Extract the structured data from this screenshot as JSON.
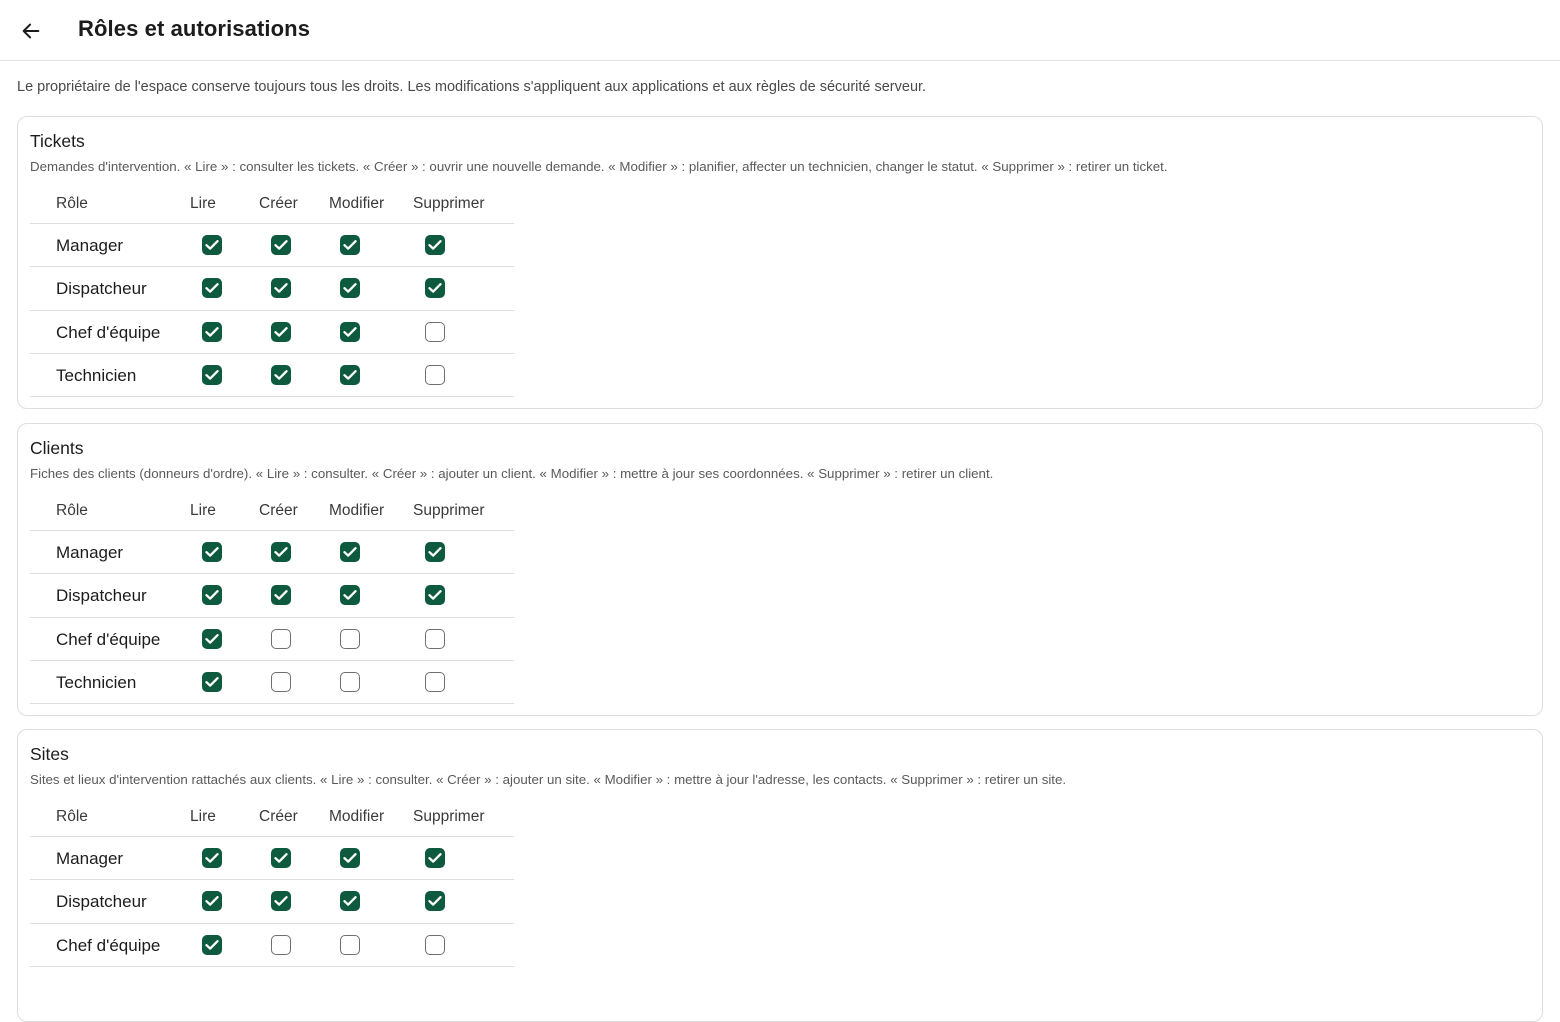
{
  "header": {
    "back_icon": "arrow-left-icon",
    "title": "Rôles et autorisations"
  },
  "intro": "Le propriétaire de l'espace conserve toujours tous les droits. Les modifications s'appliquent aux applications et aux règles de sécurité serveur.",
  "columns": {
    "role": "Rôle",
    "read": "Lire",
    "create": "Créer",
    "edit": "Modifier",
    "delete": "Supprimer"
  },
  "colors": {
    "checked": "#0e5a3f",
    "border": "#dddddd"
  },
  "sections": [
    {
      "title": "Tickets",
      "description": "Demandes d'intervention. « Lire » : consulter les tickets. « Créer » : ouvrir une nouvelle demande. « Modifier » : planifier, affecter un technicien, changer le statut. « Supprimer » : retirer un ticket.",
      "rows": [
        {
          "role": "Manager",
          "perms": [
            true,
            true,
            true,
            true
          ]
        },
        {
          "role": "Dispatcheur",
          "perms": [
            true,
            true,
            true,
            true
          ]
        },
        {
          "role": "Chef d'équipe",
          "perms": [
            true,
            true,
            true,
            false
          ]
        },
        {
          "role": "Technicien",
          "perms": [
            true,
            true,
            true,
            false
          ]
        }
      ]
    },
    {
      "title": "Clients",
      "description": "Fiches des clients (donneurs d'ordre). « Lire » : consulter. « Créer » : ajouter un client. « Modifier » : mettre à jour ses coordonnées. « Supprimer » : retirer un client.",
      "rows": [
        {
          "role": "Manager",
          "perms": [
            true,
            true,
            true,
            true
          ]
        },
        {
          "role": "Dispatcheur",
          "perms": [
            true,
            true,
            true,
            true
          ]
        },
        {
          "role": "Chef d'équipe",
          "perms": [
            true,
            false,
            false,
            false
          ]
        },
        {
          "role": "Technicien",
          "perms": [
            true,
            false,
            false,
            false
          ]
        }
      ]
    },
    {
      "title": "Sites",
      "description": "Sites et lieux d'intervention rattachés aux clients. « Lire » : consulter. « Créer » : ajouter un site. « Modifier » : mettre à jour l'adresse, les contacts. « Supprimer » : retirer un site.",
      "rows": [
        {
          "role": "Manager",
          "perms": [
            true,
            true,
            true,
            true
          ]
        },
        {
          "role": "Dispatcheur",
          "perms": [
            true,
            true,
            true,
            true
          ]
        },
        {
          "role": "Chef d'équipe",
          "perms": [
            true,
            false,
            false,
            false
          ]
        }
      ]
    }
  ]
}
